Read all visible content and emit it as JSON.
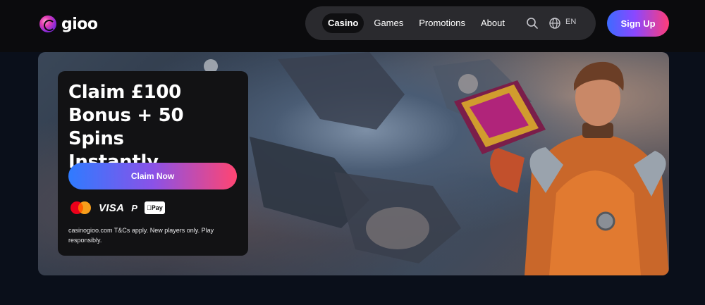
{
  "brand": {
    "name": "gioo"
  },
  "nav": {
    "items": [
      {
        "label": "Casino",
        "active": true
      },
      {
        "label": "Games",
        "active": false
      },
      {
        "label": "Promotions",
        "active": false
      },
      {
        "label": "About",
        "active": false
      }
    ],
    "search_icon": "search-icon",
    "language_icon": "globe-icon",
    "language": "EN"
  },
  "header": {
    "signup_label": "Sign Up"
  },
  "promo": {
    "title_line1": "Claim £100",
    "title_line2": "Bonus + 50 Spins",
    "title_line3": "Instantly",
    "cta_label": "Claim Now",
    "payments": {
      "mastercard_icon": "mastercard-icon",
      "visa_label": "VISA",
      "paypal_label": "P",
      "applepay_label": "Pay"
    },
    "terms": "casinogioo.com T&Cs apply. New players only. Play responsibly."
  },
  "colors": {
    "page_bg": "#0a0f1a",
    "topbar_bg": "#0b0b0d",
    "nav_bg": "#2a2a2e",
    "card_bg": "#121214",
    "accent_blue": "#2f7bff",
    "accent_pink": "#ff4572"
  }
}
